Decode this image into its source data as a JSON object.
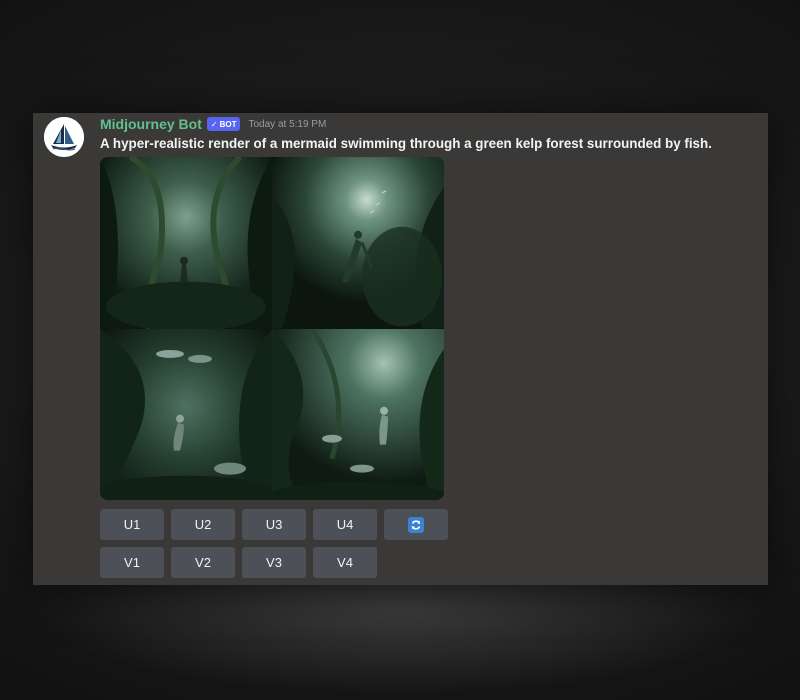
{
  "message": {
    "author": "Midjourney Bot",
    "badge": "BOT",
    "badge_icon": "check-icon",
    "timestamp": "Today at 5:19 PM",
    "prompt": "A hyper-realistic render of a mermaid swimming through a green kelp forest surrounded by fish."
  },
  "image_grid": {
    "tiles": [
      {
        "alt": "kelp-forest-tile-1"
      },
      {
        "alt": "kelp-forest-tile-2"
      },
      {
        "alt": "kelp-forest-tile-3"
      },
      {
        "alt": "kelp-forest-tile-4"
      }
    ]
  },
  "actions": {
    "upscale": [
      "U1",
      "U2",
      "U3",
      "U4"
    ],
    "variation": [
      "V1",
      "V2",
      "V3",
      "V4"
    ],
    "reroll_icon": "refresh-icon"
  },
  "colors": {
    "username": "#62c08f",
    "badge": "#5865f2",
    "panel": "#3a3937",
    "button": "#4e5057",
    "reroll": "#3b82d6"
  }
}
